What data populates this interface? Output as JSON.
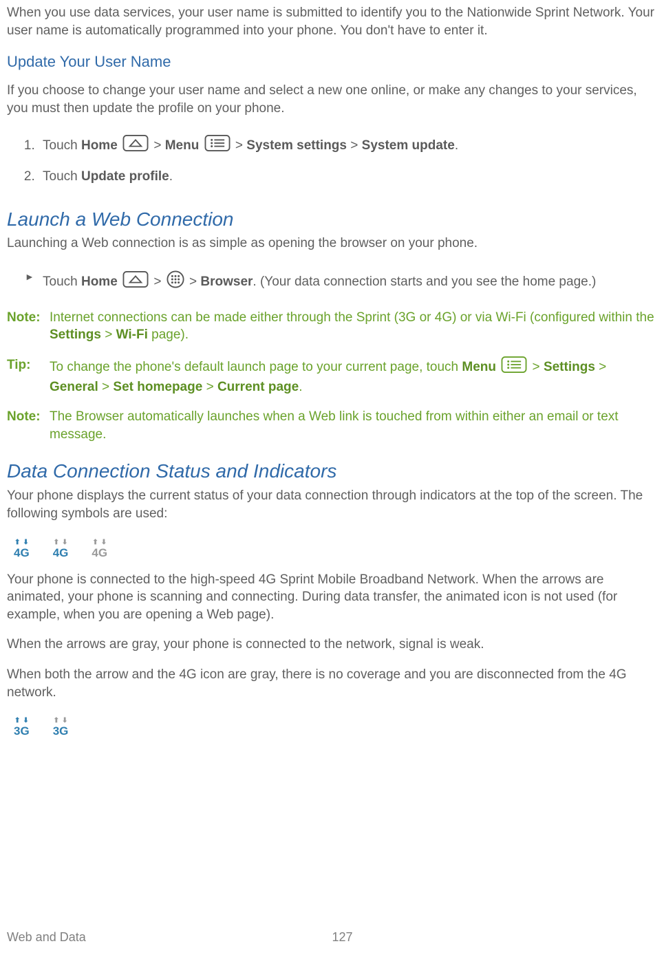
{
  "intro": "When you use data services, your user name is submitted to identify you to the Nationwide Sprint Network. Your user name is automatically programmed into your phone. You don't have to enter it.",
  "update": {
    "heading": "Update Your User Name",
    "desc": "If you choose to change your user name and select a new one online, or make any changes to your services, you must then update the profile on your phone.",
    "step1_a": "Touch ",
    "step1_home": "Home",
    "step1_b": " > ",
    "step1_menu": "Menu",
    "step1_c": " > ",
    "step1_sys": "System settings",
    "step1_d": " > ",
    "step1_upd": "System update",
    "step1_e": ".",
    "step2_a": "Touch ",
    "step2_b": "Update profile",
    "step2_c": "."
  },
  "launch": {
    "heading": "Launch a Web Connection",
    "desc": "Launching a Web connection is as simple as opening the browser on your phone.",
    "bullet_a": "Touch ",
    "bullet_home": "Home",
    "bullet_b": " > ",
    "bullet_c": " > ",
    "bullet_browser": "Browser",
    "bullet_d": ". (Your data connection starts and you see the home page.)"
  },
  "note1": {
    "label": "Note:",
    "a": "Internet connections can be made either through the Sprint (3G or 4G) or via Wi-Fi (configured within the ",
    "b": "Settings",
    "c": " > ",
    "d": "Wi-Fi",
    "e": " page)."
  },
  "tip": {
    "label": "Tip:",
    "a": "To change the phone's default launch page to your current page, touch ",
    "menu": "Menu",
    "b": " > ",
    "settings": "Settings",
    "c": " > ",
    "general": "General",
    "d": " > ",
    "sethome": "Set homepage",
    "e": " > ",
    "current": "Current page",
    "f": "."
  },
  "note2": {
    "label": "Note:",
    "text": "The Browser automatically launches when a Web link is touched from within either an email or text message."
  },
  "status": {
    "heading": "Data Connection Status and Indicators",
    "desc": "Your phone displays the current status of your data connection through indicators at the top of the screen. The following symbols are used:",
    "ind4g": "4G",
    "ind3g": "3G",
    "p1": "Your phone is connected to the high-speed 4G Sprint Mobile Broadband Network. When the arrows are animated, your phone is scanning and connecting. During data transfer, the animated icon is not used (for example, when you are opening a Web page).",
    "p2": "When the arrows are gray, your phone is connected to the network, signal is weak.",
    "p3": "When both the arrow and the 4G icon are gray, there is no coverage and you are disconnected from the 4G network."
  },
  "footer": {
    "section": "Web and Data",
    "page": "127"
  }
}
